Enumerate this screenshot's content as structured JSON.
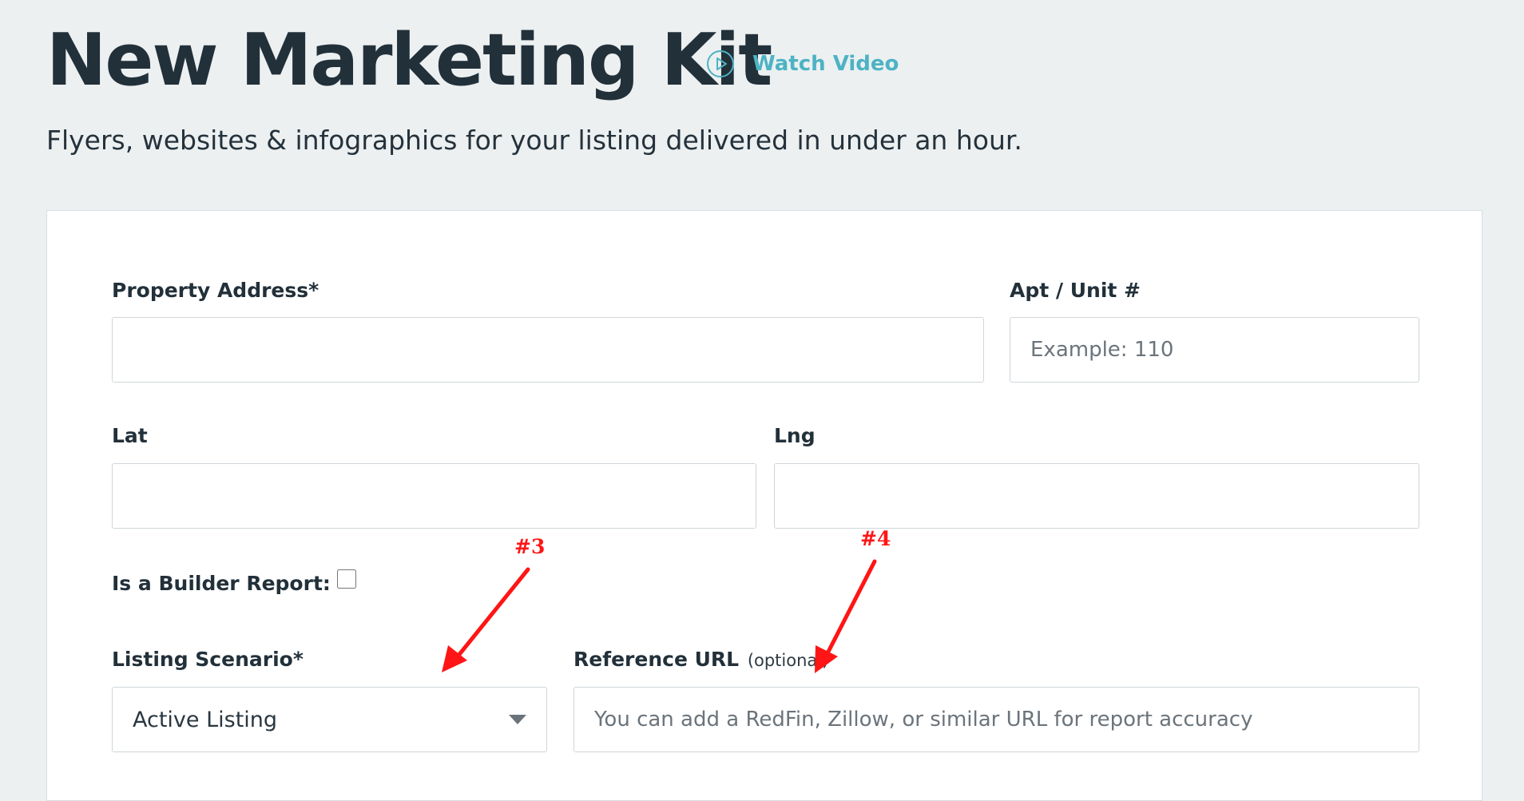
{
  "header": {
    "title": "New Marketing Kit",
    "watch_video_label": "Watch Video",
    "subtitle": "Flyers, websites & infographics for your listing delivered in under an hour."
  },
  "form": {
    "property_address": {
      "label": "Property Address*",
      "value": "",
      "placeholder": ""
    },
    "apt_unit": {
      "label": "Apt / Unit #",
      "value": "",
      "placeholder": "Example: 110"
    },
    "lat": {
      "label": "Lat",
      "value": "",
      "placeholder": ""
    },
    "lng": {
      "label": "Lng",
      "value": "",
      "placeholder": ""
    },
    "builder_report": {
      "label": "Is a Builder Report:",
      "checked": false
    },
    "listing_scenario": {
      "label": "Listing Scenario*",
      "selected": "Active Listing"
    },
    "reference_url": {
      "label": "Reference URL",
      "label_optional": "(optional)",
      "value": "",
      "placeholder": "You can add a RedFin, Zillow, or similar URL for report accuracy"
    }
  },
  "annotations": {
    "marker_3": "#3",
    "marker_4": "#4"
  },
  "colors": {
    "page_background": "#ecf0f1",
    "accent": "#4cb3c4",
    "text_primary": "#22303a",
    "annotation_red": "#ff1515"
  }
}
